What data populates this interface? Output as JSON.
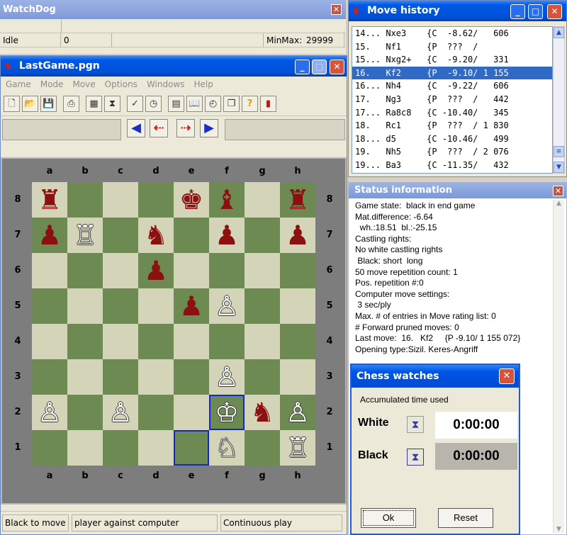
{
  "watchdog": {
    "title": "WatchDog",
    "state": "Idle",
    "count": "0",
    "minmax_label": "MinMax:",
    "minmax_value": "29999"
  },
  "game_window": {
    "title": "LastGame.pgn",
    "menu": [
      "Game",
      "Mode",
      "Move",
      "Options",
      "Windows",
      "Help"
    ],
    "status": {
      "turn": "Black to move",
      "mode": "player against computer",
      "play": "Continuous play"
    }
  },
  "board": {
    "files": [
      "a",
      "b",
      "c",
      "d",
      "e",
      "f",
      "g",
      "h"
    ],
    "ranks": [
      "8",
      "7",
      "6",
      "5",
      "4",
      "3",
      "2",
      "1"
    ],
    "highlight_squares": [
      "f2",
      "e1"
    ]
  },
  "history": {
    "title": "Move history",
    "rows": [
      "14... Nxe3    {C  -8.62/   606",
      "15.   Nf1     {P  ???  /      ",
      "15... Nxg2+   {C  -9.20/   331",
      "16.   Kf2     {P  -9.10/ 1 155",
      "16... Nh4     {C  -9.22/   606",
      "17.   Ng3     {P  ???  /   442",
      "17... Ra8c8   {C -10.40/   345",
      "18.   Rc1     {P  ???  / 1 830",
      "18... d5      {C -10.46/   499",
      "19.   Nh5     {P  ???  / 2 076",
      "19... Ba3     {C -11.35/   432"
    ],
    "selected_index": 3
  },
  "status_info": {
    "title": "Status information",
    "lines": [
      "Game state:  black in end game",
      "Mat.difference: -6.64",
      "  wh.:18.51  bl.:-25.15",
      "Castling rights:",
      "No white castling rights",
      " Black: short  long",
      "50 move repetition count: 1",
      "Pos. repetition #:0",
      "Computer move settings:",
      " 3 sec/ply",
      "Max. # of entries in Move rating list: 0",
      "# Forward pruned moves: 0",
      "Last move:  16.   Kf2     {P -9.10/ 1 155 072}",
      "Opening type:Sizil. Keres-Angriff"
    ]
  },
  "watches": {
    "title": "Chess watches",
    "caption": "Accumulated time used",
    "white_label": "White",
    "white_time": "0:00:00",
    "black_label": "Black",
    "black_time": "0:00:00",
    "ok_label": "Ok",
    "reset_label": "Reset"
  }
}
